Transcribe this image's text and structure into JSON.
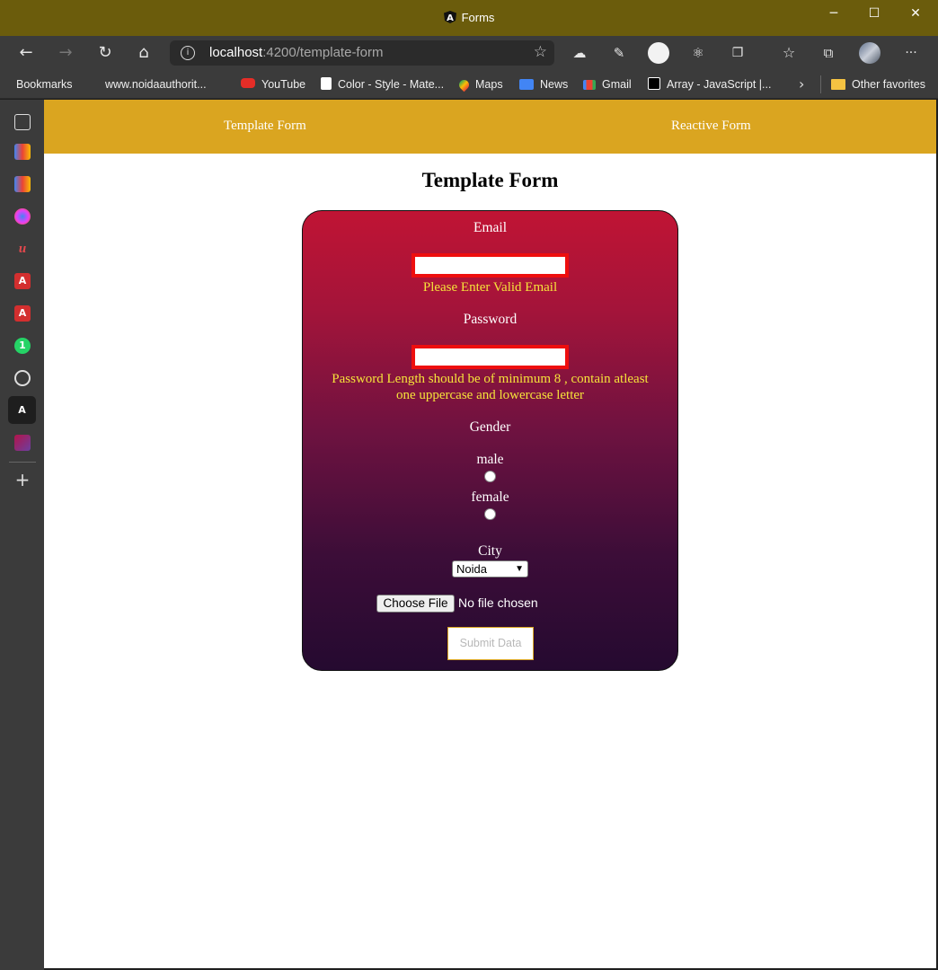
{
  "window": {
    "title": "Forms",
    "minimize_icon": "─",
    "maximize_icon": "☐",
    "close_icon": "✕"
  },
  "toolbar": {
    "url_host": "localhost",
    "url_rest": ":4200/template-form",
    "info_icon": "i",
    "more_icon": "···"
  },
  "bookmarks": {
    "items": [
      {
        "label": "Bookmarks",
        "icon": "page-icon"
      },
      {
        "label": "www.noidaauthorit...",
        "icon": "page-icon"
      },
      {
        "label": "YouTube",
        "icon": "youtube-icon"
      },
      {
        "label": "Color - Style - Mate...",
        "icon": "material-icon"
      },
      {
        "label": "Maps",
        "icon": "maps-icon"
      },
      {
        "label": "News",
        "icon": "news-icon"
      },
      {
        "label": "Gmail",
        "icon": "gmail-icon"
      },
      {
        "label": "Array - JavaScript |...",
        "icon": "js-icon"
      }
    ],
    "other": "Other favorites"
  },
  "nav": {
    "template_link": "Template Form",
    "reactive_link": "Reactive Form"
  },
  "form": {
    "heading": "Template Form",
    "email_label": "Email",
    "email_value": "",
    "email_error": "Please Enter Valid Email",
    "password_label": "Password",
    "password_value": "",
    "password_error_line1": "Password Length should be of minimum 8 , contain atleast",
    "password_error_line2": "one uppercase and lowercase letter",
    "gender_label": "Gender",
    "gender_male": "male",
    "gender_female": "female",
    "city_label": "City",
    "city_selected": "Noida",
    "file_button": "Choose File",
    "file_status": "No file chosen",
    "submit_label": "Submit Data"
  },
  "colors": {
    "titlebar": "#6b5c0c",
    "nav": "#daa520",
    "card_top": "#c01434",
    "card_bottom": "#250a30",
    "error_text": "#f6e33a",
    "input_border": "#ee0e0e"
  }
}
